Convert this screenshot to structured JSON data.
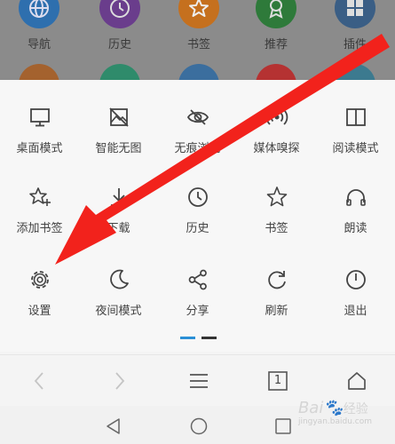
{
  "background_shortcuts": {
    "row1": [
      {
        "label": "导航",
        "color": "#2e6fae",
        "icon": "globe-icon"
      },
      {
        "label": "历史",
        "color": "#6a3d8c",
        "icon": "clock-icon"
      },
      {
        "label": "书签",
        "color": "#c5701e",
        "icon": "star-icon"
      },
      {
        "label": "推荐",
        "color": "#2e7a3a",
        "icon": "badge-icon"
      },
      {
        "label": "插件",
        "color": "#3a5e85",
        "icon": "grid-icon"
      }
    ],
    "row2_colors": [
      "#a4622e",
      "#2f8b6b",
      "#3b6e9e",
      "#b53232",
      "#3c7a8f"
    ]
  },
  "menu": {
    "rows": [
      [
        {
          "label": "桌面模式",
          "icon": "monitor-icon"
        },
        {
          "label": "智能无图",
          "icon": "no-image-icon"
        },
        {
          "label": "无痕浏览",
          "icon": "eye-slash-icon"
        },
        {
          "label": "媒体嗅探",
          "icon": "broadcast-icon"
        },
        {
          "label": "阅读模式",
          "icon": "book-icon"
        }
      ],
      [
        {
          "label": "添加书签",
          "icon": "star-plus-icon"
        },
        {
          "label": "下载",
          "icon": "download-icon"
        },
        {
          "label": "历史",
          "icon": "clock-icon"
        },
        {
          "label": "书签",
          "icon": "star-icon"
        },
        {
          "label": "朗读",
          "icon": "headphones-icon"
        }
      ],
      [
        {
          "label": "设置",
          "icon": "gear-icon"
        },
        {
          "label": "夜间模式",
          "icon": "moon-icon"
        },
        {
          "label": "分享",
          "icon": "share-icon"
        },
        {
          "label": "刷新",
          "icon": "refresh-icon"
        },
        {
          "label": "退出",
          "icon": "power-icon"
        }
      ]
    ],
    "page_indicator": {
      "active_index": 0,
      "count": 2,
      "active_color": "#2a8fd6",
      "inactive_color": "#333333"
    }
  },
  "toolbar": {
    "tab_count": "1",
    "buttons": [
      "back-icon",
      "forward-icon",
      "menu-icon",
      "tabs-icon",
      "home-icon"
    ]
  },
  "system_nav": {
    "buttons": [
      "back-triangle-icon",
      "home-circle-icon",
      "recents-square-icon"
    ]
  },
  "watermark": {
    "text": "Bai",
    "subtext": "jingyan.baidu.com",
    "paw": "经验"
  },
  "annotation": {
    "color": "#f2221c"
  }
}
